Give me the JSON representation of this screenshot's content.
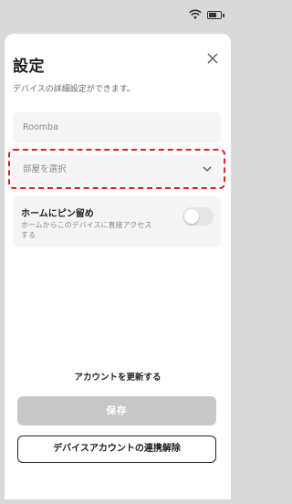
{
  "dialog": {
    "title": "設定",
    "subtitle": "デバイスの詳細設定ができます。"
  },
  "fields": {
    "device_name": {
      "value": "Roomba"
    },
    "room": {
      "placeholder": "部屋を選択"
    }
  },
  "pin_home": {
    "title": "ホームにピン留め",
    "description": "ホームからこのデバイスに直接アクセスする",
    "enabled": false
  },
  "actions": {
    "update_account": "アカウントを更新する",
    "save": "保存",
    "unlink": "デバイスアカウントの連携解除"
  },
  "icons": {
    "close": "close-icon",
    "chevron": "chevron-down-icon",
    "wifi": "wifi-icon",
    "battery": "battery-icon"
  },
  "colors": {
    "highlight": "#e02020",
    "save_disabled": "#c8c8c8"
  }
}
